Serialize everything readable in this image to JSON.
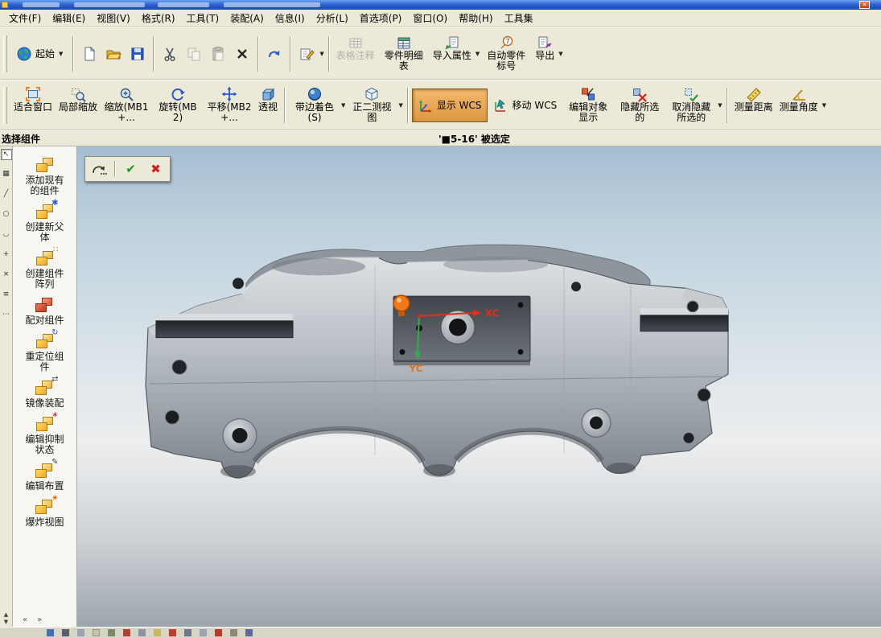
{
  "menubar": {
    "items": [
      "文件(F)",
      "编辑(E)",
      "视图(V)",
      "格式(R)",
      "工具(T)",
      "装配(A)",
      "信息(I)",
      "分析(L)",
      "首选项(P)",
      "窗口(O)",
      "帮助(H)",
      "工具集"
    ]
  },
  "toolbar_standard": {
    "start_label": "起始",
    "table_annotation_label": "表格注释",
    "parts_list_label": "零件明细表",
    "import_attributes_label": "导入属性",
    "auto_balloon_label": "自动零件标号",
    "export_label": "导出"
  },
  "toolbar_view": {
    "fit_label": "适合窗口",
    "zoom_area_label": "局部缩放",
    "zoom_label": "缩放(MB1+...",
    "rotate_label": "旋转(MB2)",
    "pan_label": "平移(MB2+...",
    "perspective_label": "透视",
    "shaded_label": "带边着色(S)",
    "view_label": "正二测视图",
    "display_wcs_label": "显示 WCS",
    "move_wcs_label": "移动 WCS",
    "edit_object_display_label": "编辑对象显示",
    "hide_label": "隐藏所选的",
    "unhide_label": "取消隐藏所选的",
    "measure_distance_label": "测量距离",
    "measure_angle_label": "测量角度"
  },
  "prompt": {
    "command": "选择组件",
    "status": "'■5-16' 被选定"
  },
  "assembly_panel": {
    "items": [
      {
        "label": "添加现有的组件"
      },
      {
        "label": "创建新父体"
      },
      {
        "label": "创建组件阵列"
      },
      {
        "label": "配对组件"
      },
      {
        "label": "重定位组件"
      },
      {
        "label": "镜像装配"
      },
      {
        "label": "编辑抑制状态"
      },
      {
        "label": "编辑布置"
      },
      {
        "label": "爆炸视图"
      }
    ]
  },
  "viewport": {
    "wcs": {
      "x_label": "XC",
      "y_label": "YC"
    },
    "mini_toolbar": {
      "accept_glyph": "✔",
      "cancel_glyph": "✖"
    }
  }
}
